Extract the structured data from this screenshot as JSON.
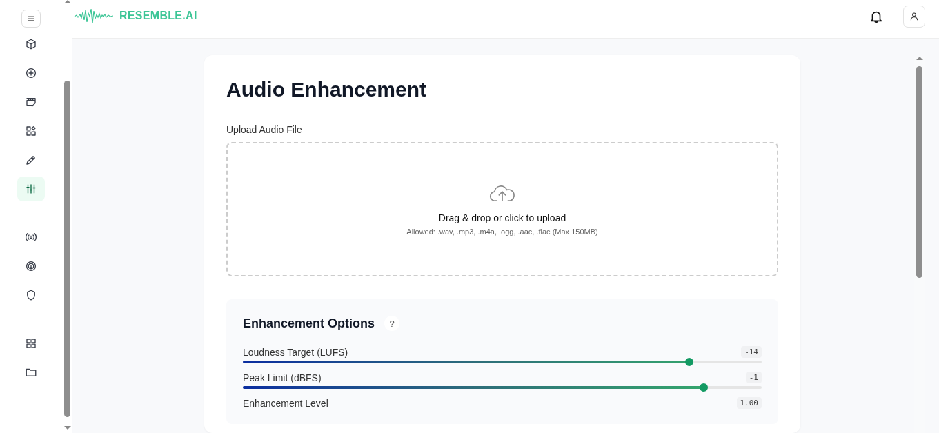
{
  "sidebar": {
    "groups": [
      {
        "items": [
          {
            "kind": "cube",
            "selected": false
          },
          {
            "kind": "plus-circle",
            "selected": false
          },
          {
            "kind": "clapperboard",
            "selected": false
          },
          {
            "kind": "shapes",
            "selected": false
          },
          {
            "kind": "pencil",
            "selected": false
          },
          {
            "kind": "sliders",
            "selected": true
          }
        ]
      },
      {
        "items": [
          {
            "kind": "broadcast",
            "selected": false
          },
          {
            "kind": "target",
            "selected": false
          },
          {
            "kind": "shield",
            "selected": false
          }
        ]
      },
      {
        "items": [
          {
            "kind": "grid",
            "selected": false
          },
          {
            "kind": "folder",
            "selected": false
          }
        ]
      }
    ]
  },
  "header": {
    "logo": "RESEMBLE.AI"
  },
  "page": {
    "title": "Audio Enhancement",
    "upload": {
      "label": "Upload Audio File",
      "prompt": "Drag & drop or click to upload",
      "hint": "Allowed: .wav, .mp3, .m4a, .ogg, .aac, .flac (Max 150MB)"
    },
    "options": {
      "title": "Enhancement Options",
      "help": "?",
      "controls": [
        {
          "label": "Loudness Target (LUFS)",
          "reading": "-14",
          "level": 0.86
        },
        {
          "label": "Peak Limit (dBFS)",
          "reading": "-1",
          "level": 0.888
        },
        {
          "label": "Enhancement Level",
          "reading": "1.00"
        }
      ]
    }
  }
}
